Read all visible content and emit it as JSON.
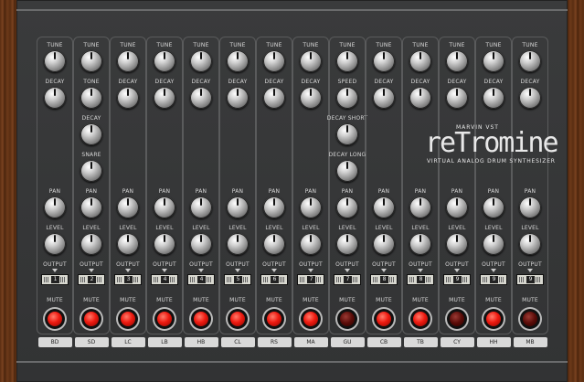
{
  "brand": {
    "maker": "MARVIN VST",
    "name": "reTromine",
    "tagline": "VIRTUAL ANALOG DRUM SYNTHESIZER"
  },
  "labels": {
    "tune": "TUNE",
    "decay": "DECAY",
    "tone": "TONE",
    "snare": "SNARE",
    "speed": "SPEED",
    "decay_short": "DECAY SHORT",
    "decay_long": "DECAY LONG",
    "pan": "PAN",
    "level": "LEVEL",
    "output": "OUTPUT",
    "mute": "MUTE"
  },
  "channels": [
    {
      "name": "BD",
      "output": "1",
      "mute_on": true
    },
    {
      "name": "SD",
      "output": "2",
      "mute_on": true
    },
    {
      "name": "LC",
      "output": "3",
      "mute_on": true
    },
    {
      "name": "LB",
      "output": "4",
      "mute_on": true
    },
    {
      "name": "HB",
      "output": "4",
      "mute_on": true
    },
    {
      "name": "CL",
      "output": "5",
      "mute_on": true
    },
    {
      "name": "RS",
      "output": "6",
      "mute_on": true
    },
    {
      "name": "MA",
      "output": "7",
      "mute_on": true
    },
    {
      "name": "GU",
      "output": "7",
      "mute_on": false
    },
    {
      "name": "CB",
      "output": "8",
      "mute_on": true
    },
    {
      "name": "TB",
      "output": "8",
      "mute_on": true
    },
    {
      "name": "CY",
      "output": "9",
      "mute_on": false
    },
    {
      "name": "HH",
      "output": "9",
      "mute_on": true
    },
    {
      "name": "MB",
      "output": "9",
      "mute_on": false
    }
  ]
}
